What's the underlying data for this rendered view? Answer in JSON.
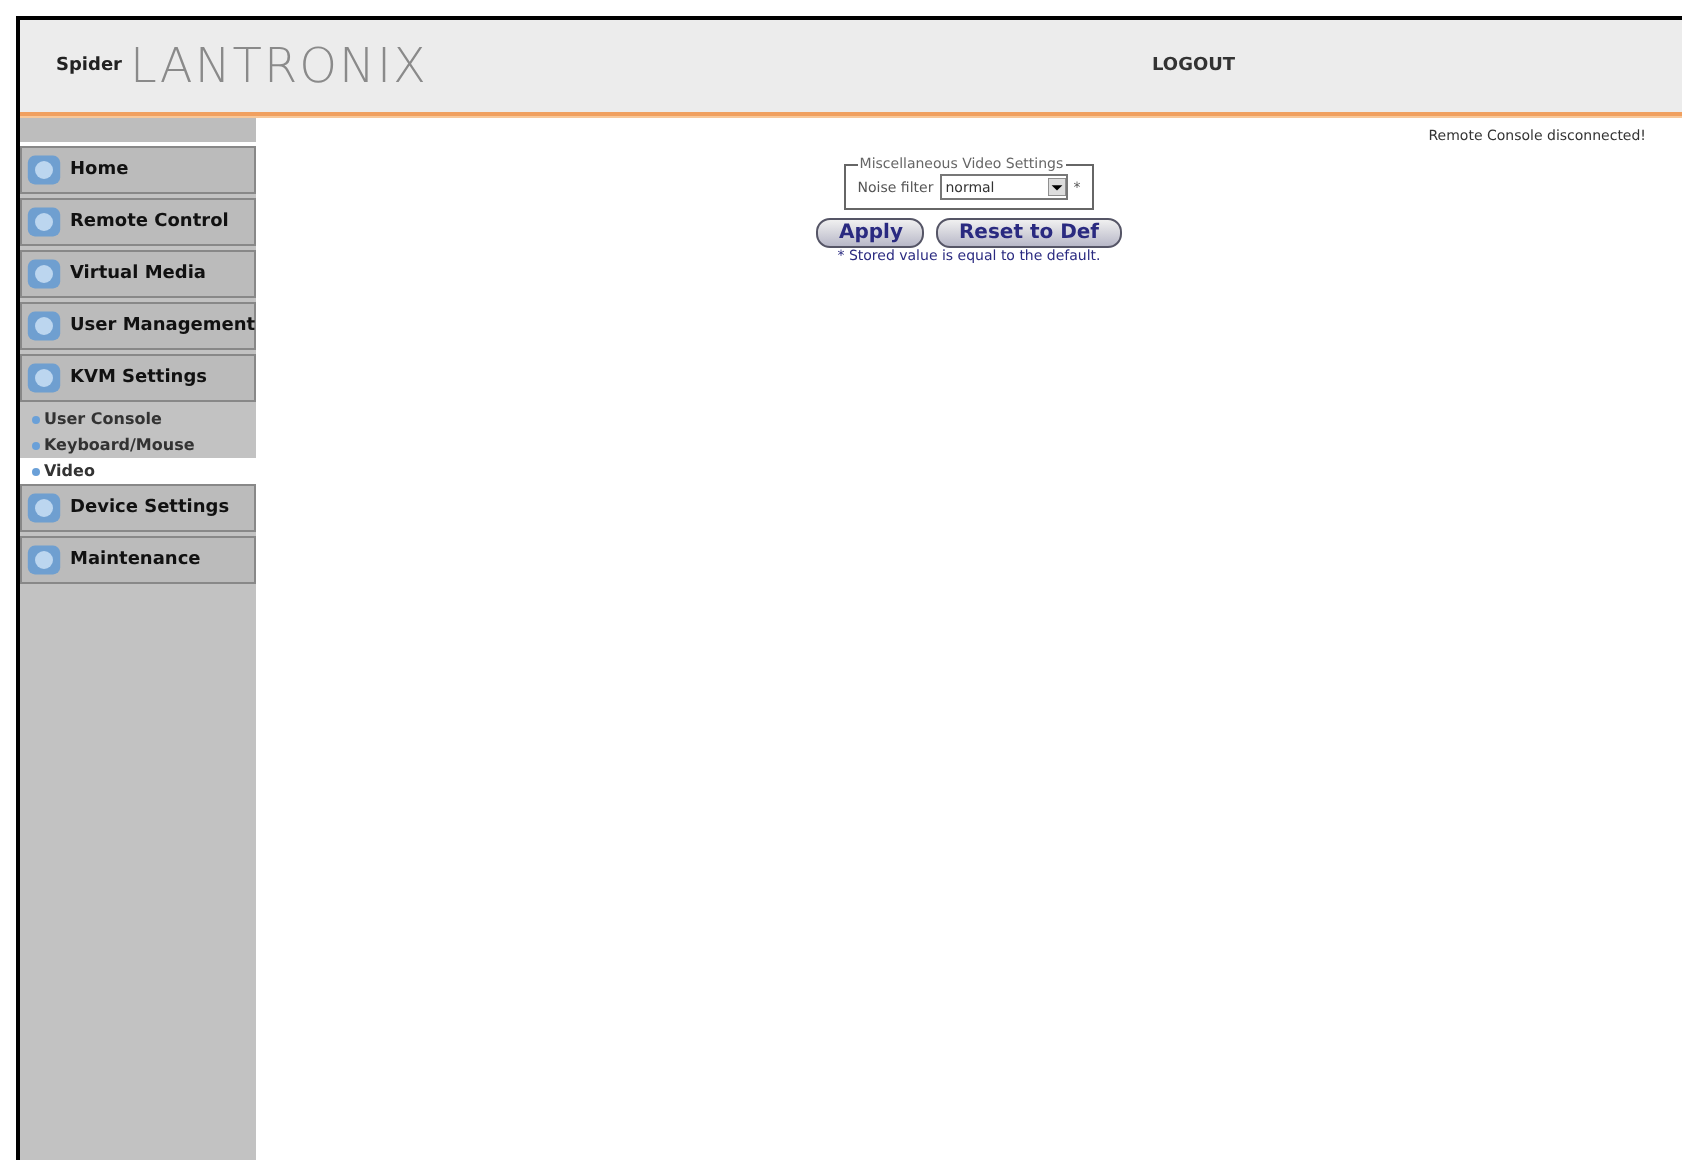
{
  "header": {
    "logo_badge": "Spider",
    "logo_text": "LANTRONIX",
    "logout": "LOGOUT"
  },
  "status": "Remote Console disconnected!",
  "sidebar": {
    "items": [
      {
        "label": "Home",
        "kind": "main",
        "selected": false
      },
      {
        "label": "Remote Control",
        "kind": "main",
        "selected": false
      },
      {
        "label": "Virtual Media",
        "kind": "main",
        "selected": false
      },
      {
        "label": "User Management",
        "kind": "main",
        "selected": false
      },
      {
        "label": "KVM Settings",
        "kind": "main",
        "selected": false
      },
      {
        "label": "User Console",
        "kind": "sub",
        "selected": false
      },
      {
        "label": "Keyboard/Mouse",
        "kind": "sub",
        "selected": false
      },
      {
        "label": "Video",
        "kind": "sub",
        "selected": true
      },
      {
        "label": "Device Settings",
        "kind": "main",
        "selected": false
      },
      {
        "label": "Maintenance",
        "kind": "main",
        "selected": false
      }
    ]
  },
  "settings": {
    "legend": "Miscellaneous Video Settings",
    "field_label": "Noise filter",
    "field_value": "normal",
    "field_mark": "*",
    "buttons": [
      "Apply",
      "Reset to Def"
    ],
    "note": "* Stored value is equal to the default."
  }
}
